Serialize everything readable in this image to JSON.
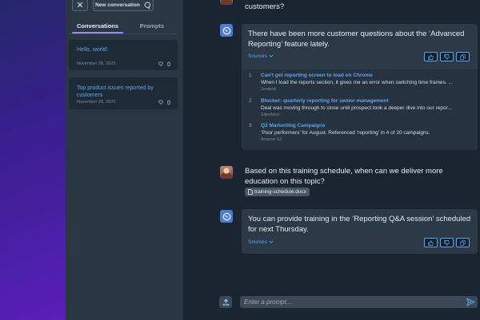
{
  "sidebar": {
    "new_conversation_label": "New conversation",
    "tabs": [
      {
        "label": "Conversations",
        "active": true
      },
      {
        "label": "Prompts",
        "active": false
      }
    ],
    "conversations": [
      {
        "title": "Hello, world!",
        "date": "November 28, 2023"
      },
      {
        "title": "Top product issues reported by customers",
        "date": "November 28, 2023"
      }
    ]
  },
  "chat": {
    "messages": [
      {
        "role": "user",
        "text": "customers?"
      },
      {
        "role": "bot",
        "text": "There have been more customer questions about the ‘Advanced Reporting’ feature lately.",
        "sources_label": "Sources"
      },
      {
        "role": "user",
        "text": "Based on this training schedule, when can we deliver more education on this topic?",
        "attachment": "training-schedule.docx"
      },
      {
        "role": "bot",
        "text": "You can provide training in the ‘Reporting Q&A session’ scheduled for next Thursday.",
        "sources_label": "Sources"
      }
    ],
    "sources": [
      {
        "num": "1",
        "title": "Can't get reporting screen to load on Chrome",
        "snippet": "When I load the reports section, it gives me an error when switching time frames. ...",
        "origin": "Zendesk"
      },
      {
        "num": "2",
        "title": "Blocker: quarterly reporting for senior management",
        "snippet": "Deal was moving through to close until prospect took a deeper dive into our repor...",
        "origin": "Salesforce"
      },
      {
        "num": "3",
        "title": "Q3 Markerting Campaigns",
        "snippet": "‘Poor performers’ for August. Referenced ‘reporting’ in 4 of 20 campaigns.",
        "origin": "Amazon S3"
      }
    ]
  },
  "input": {
    "placeholder": "Enter a prompt..."
  },
  "colors": {
    "accent": "#5aa7f0",
    "tab_underline": "#9b8cf0",
    "bot_avatar": "#4a7bd6",
    "bg_gradient_end": "#5a1fb8"
  }
}
